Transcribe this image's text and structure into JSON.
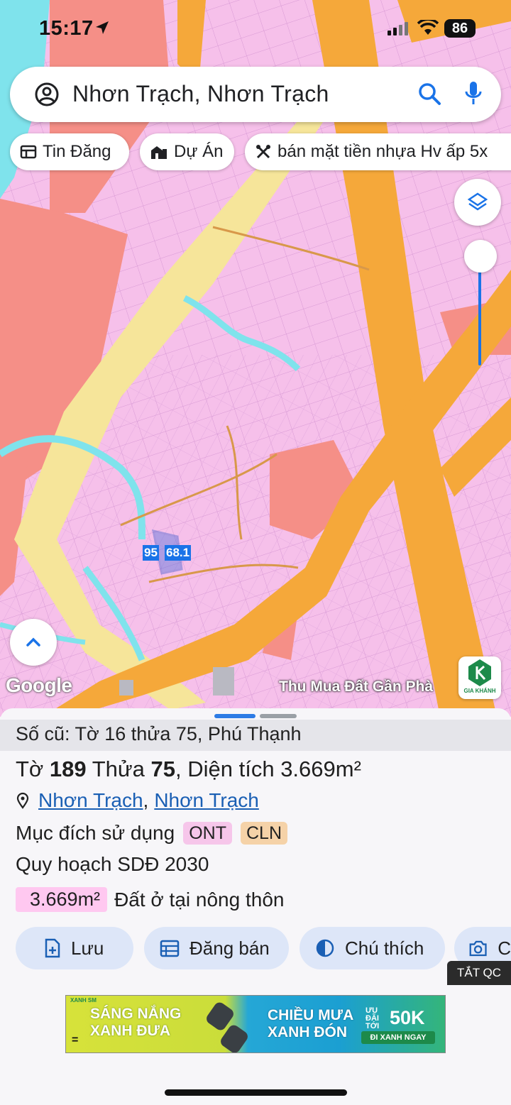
{
  "status": {
    "time": "15:17",
    "battery": "86"
  },
  "search": {
    "query": "Nhơn Trạch, Nhơn Trạch"
  },
  "chips": [
    {
      "label": "Tin Đăng",
      "icon": "table-icon"
    },
    {
      "label": "Dự Án",
      "icon": "building-icon"
    },
    {
      "label": "bán mặt tiền nhựa Hv ấp 5x",
      "icon": "tools-icon"
    }
  ],
  "map": {
    "parcel_label_left": "95",
    "parcel_label_right": "68.1",
    "google_logo": "Google",
    "promo": "Thu Mua Đất Gần Phà",
    "logo_caption": "GIA KHÁNH",
    "colors": {
      "residential": "#f6c0ea",
      "road": "#f5a83a",
      "water": "#7fe3ec",
      "commercial": "#f58f87",
      "yellow": "#f6e59a"
    }
  },
  "sheet": {
    "old_ref": "Số cũ: Tờ 16 thửa 75, Phú Thạnh",
    "parcel": {
      "to_label": "Tờ",
      "to": "189",
      "thua_label": "Thửa",
      "thua": "75",
      "area_label": "Diện tích",
      "area": "3.669m²"
    },
    "location": {
      "part1": "Nhơn Trạch",
      "sep": ",",
      "part2": "Nhơn Trạch"
    },
    "purpose_label": "Mục đích sử dụng",
    "tags": [
      {
        "label": "ONT",
        "color": "#f6c6ea"
      },
      {
        "label": "CLN",
        "color": "#f5d2a8"
      }
    ],
    "plan_label": "Quy hoạch SDĐ 2030",
    "area_badge": "3.669m²",
    "area_desc": "Đất ở tại nông thôn",
    "actions": [
      {
        "label": "Lưu",
        "icon": "save-doc-icon"
      },
      {
        "label": "Đăng bán",
        "icon": "calendar-icon"
      },
      {
        "label": "Chú thích",
        "icon": "contrast-icon"
      },
      {
        "label": "C",
        "icon": "camera-icon"
      }
    ],
    "ad_close": "TẮT QC"
  },
  "ad": {
    "brand": "XANH SM",
    "line1a": "SÁNG NẮNG",
    "line1b": "XANH ĐƯA",
    "line2a": "CHIỀU MƯA",
    "line2b": "XANH ĐÓN",
    "promo_small": "ƯU ĐÃI TỚI",
    "promo_big": "50K",
    "cta": "ĐI XANH NGAY",
    "eq": "="
  }
}
